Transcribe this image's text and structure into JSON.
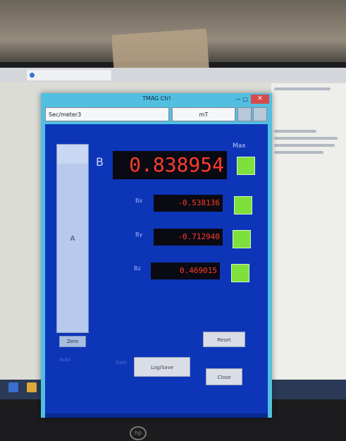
{
  "app": {
    "title": "TMAG Ctrl",
    "dropdown_device": "Sec/meter3",
    "dropdown_unit": "mT",
    "main_label": "B",
    "main_value": "0.838954",
    "max_label": "Max",
    "bar_level": 0.9,
    "bar_label": "A",
    "bar_button": "Zero",
    "components": [
      {
        "label": "Bx",
        "value": "-0.538136"
      },
      {
        "label": "By",
        "value": "-0.712940"
      },
      {
        "label": "Bz",
        "value": "0.469015"
      }
    ],
    "buttons": {
      "reset": "Reset",
      "record": "Log/Save",
      "close": "Close"
    },
    "faint_labels": [
      "Auto",
      "Gain"
    ],
    "indicator_color": "#7ee03a"
  }
}
